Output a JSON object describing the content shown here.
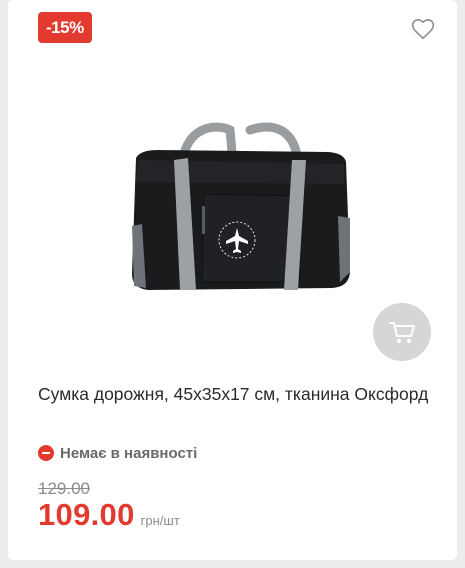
{
  "product": {
    "discount": "-15%",
    "title": "Сумка дорожня, 45х35х17 см, тканина Оксфорд",
    "stock_status": "Немає в наявності",
    "old_price": "129.00",
    "price": "109.00",
    "unit": "грн/шт"
  },
  "icons": {
    "favorite": "heart-outline-icon",
    "cart": "shopping-cart-icon",
    "stock": "minus-circle-icon"
  },
  "colors": {
    "accent": "#e23a2e",
    "cart_button": "#d6d6d6",
    "muted_text": "#8c8c8c"
  }
}
